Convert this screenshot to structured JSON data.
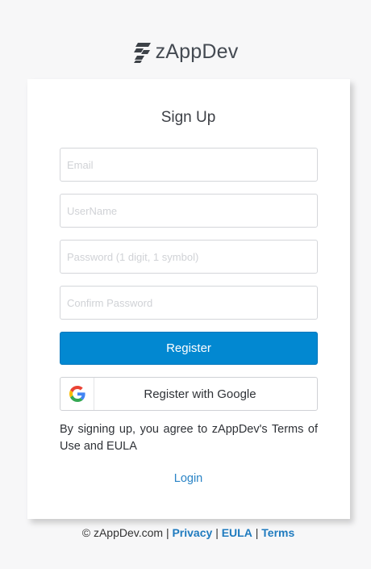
{
  "brand": {
    "name": "zAppDev",
    "logo_color": "#3d4248"
  },
  "form": {
    "title": "Sign Up",
    "email_placeholder": "Email",
    "username_placeholder": "UserName",
    "password_placeholder": "Password (1 digit, 1 symbol)",
    "confirm_placeholder": "Confirm Password",
    "register_label": "Register",
    "google_label": "Register with Google",
    "terms_text": "By signing up, you agree to zAppDev's Terms of Use and EULA",
    "login_label": "Login"
  },
  "footer": {
    "copyright": "© zAppDev.com",
    "separator": "|",
    "privacy": "Privacy",
    "eula": "EULA",
    "terms": "Terms"
  },
  "colors": {
    "primary": "#0288d1",
    "link": "#2a84c6",
    "background": "#f7f7f8"
  }
}
